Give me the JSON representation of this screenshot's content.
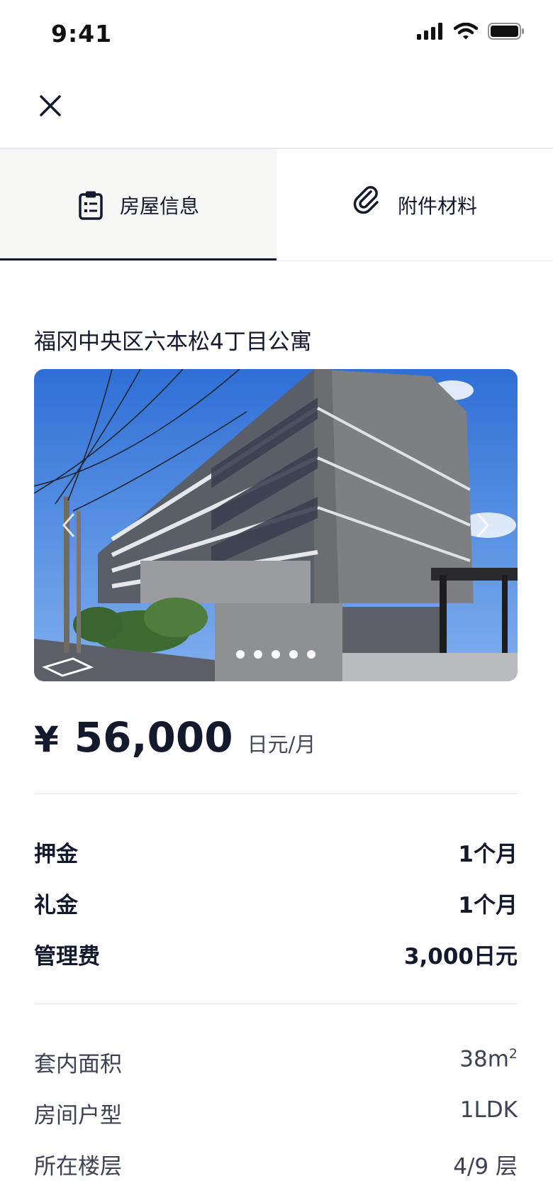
{
  "status_bar": {
    "time": "9:41"
  },
  "tabs": [
    {
      "label": "房屋信息",
      "icon": "clipboard-icon",
      "active": true
    },
    {
      "label": "附件材料",
      "icon": "paperclip-icon",
      "active": false
    }
  ],
  "listing": {
    "title": "福冈中央区六本松4丁目公寓",
    "gallery": {
      "slide_count": 5,
      "active_index": 0
    },
    "price": {
      "symbol": "¥",
      "amount": "56,000",
      "unit": "日元/月"
    },
    "fees": [
      {
        "label": "押金",
        "value": "1个月"
      },
      {
        "label": "礼金",
        "value": "1个月"
      },
      {
        "label": "管理费",
        "value": "3,000日元"
      }
    ],
    "details": {
      "area": {
        "label": "套内面积",
        "value": "38m",
        "unit_sup": "2"
      },
      "layout": {
        "label": "房间户型",
        "value": "1LDK"
      },
      "floor": {
        "label": "所在楼层",
        "value": "4/9 层"
      }
    }
  },
  "colors": {
    "text_primary": "#141a2e",
    "text_secondary": "#3c4254",
    "active_tab_bg": "#f6f6f4",
    "divider": "#e4e5e8"
  }
}
